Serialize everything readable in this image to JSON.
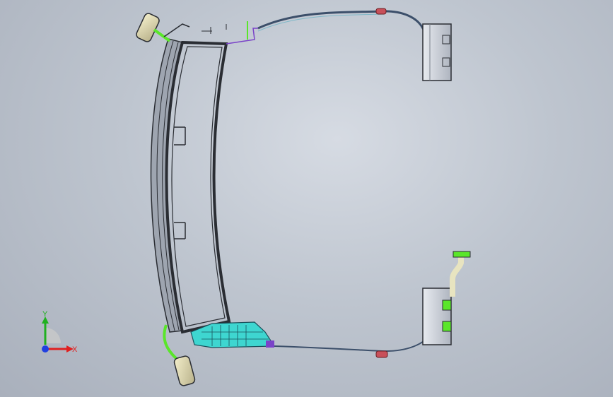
{
  "viewport": {
    "background_top": "#d6dbe3",
    "background_bottom": "#a9b0bc"
  },
  "model": {
    "frame_color": "#2a2d33",
    "glass_color": "#c9cfd8",
    "accent_green": "#5ae62a",
    "accent_cyan": "#3ed6d0",
    "accent_purple": "#7a43c8",
    "connector_red": "#c8505a",
    "mirror_color": "#e7e2b8"
  },
  "triad": {
    "x_label": "X",
    "y_label": "Y",
    "x_color": "#e02020",
    "y_color": "#20b020",
    "origin_color": "#2040e0"
  }
}
